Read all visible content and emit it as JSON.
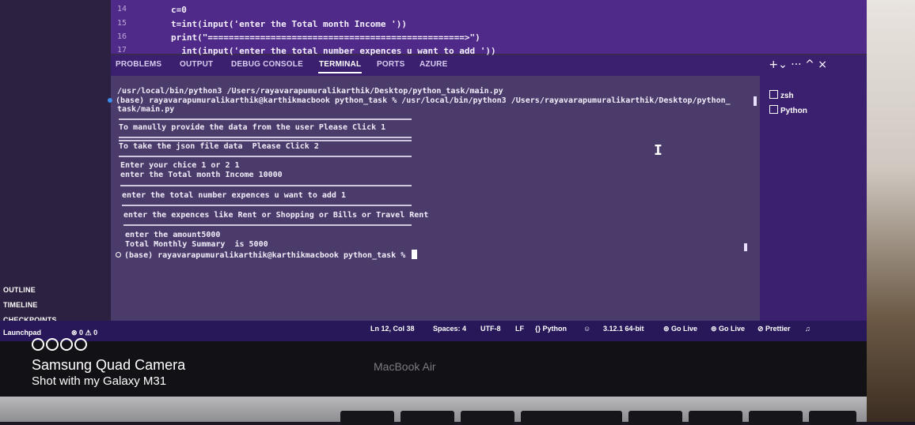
{
  "editor": {
    "line_numbers": [
      "14",
      "15",
      "16",
      "17"
    ],
    "code_lines": [
      "c=0",
      "t=int(input('enter the Total month Income '))",
      "print(\"=================================================>\")",
      "  int(input('enter the total number expences u want to add '))"
    ]
  },
  "panel": {
    "tabs": [
      "PROBLEMS",
      "OUTPUT",
      "DEBUG CONSOLE",
      "TERMINAL",
      "PORTS",
      "AZURE"
    ],
    "active_tab": "TERMINAL",
    "actions": "+⌄ ··· ^ ×"
  },
  "terminal": {
    "lines": [
      "/usr/local/bin/python3 /Users/rayavarapumuralikarthik/Desktop/python_task/main.py",
      "(base) rayavarapumuralikarthik@karthikmacbook python_task % /usr/local/bin/python3 /Users/rayavarapumuralikarthik/Desktop/python_",
      "task/main.py",
      "To manully provide the data from the user Please Click 1",
      "To take the json file data  Please Click 2",
      "Enter your chice 1 or 2 1",
      "enter the Total month Income 10000",
      "enter the total number expences u want to add 1",
      "enter the expences like Rent or Shopping or Bills or Travel Rent",
      "enter the amount5000",
      "Total Monthly Summary  is 5000",
      "(base) rayavarapumuralikarthik@karthikmacbook python_task % "
    ],
    "sessions": [
      "zsh",
      "Python"
    ]
  },
  "sidebar": {
    "sections": [
      "OUTLINE",
      "TIMELINE",
      "CHECKPOINTS"
    ]
  },
  "statusbar": {
    "left": "Launchpad",
    "problems": "⊗ 0 ⚠ 0",
    "position": "Ln 12, Col 38",
    "spaces": "Spaces: 4",
    "encoding": "UTF-8",
    "eol": "LF",
    "language": "{} Python",
    "interpreter": "3.12.1 64-bit",
    "golive1": "Go Live",
    "golive2": "Go Live",
    "prettier": "Prettier"
  },
  "hardware": {
    "laptop_label": "MacBook Air"
  },
  "watermark": {
    "title": "Samsung Quad Camera",
    "subtitle": "Shot with my Galaxy M31"
  },
  "colors": {
    "terminal_bg": "#4a3b6b",
    "editor_bg": "#4f2a88",
    "statusbar_bg": "#28185a",
    "dot_blue": "#3b8eea"
  }
}
